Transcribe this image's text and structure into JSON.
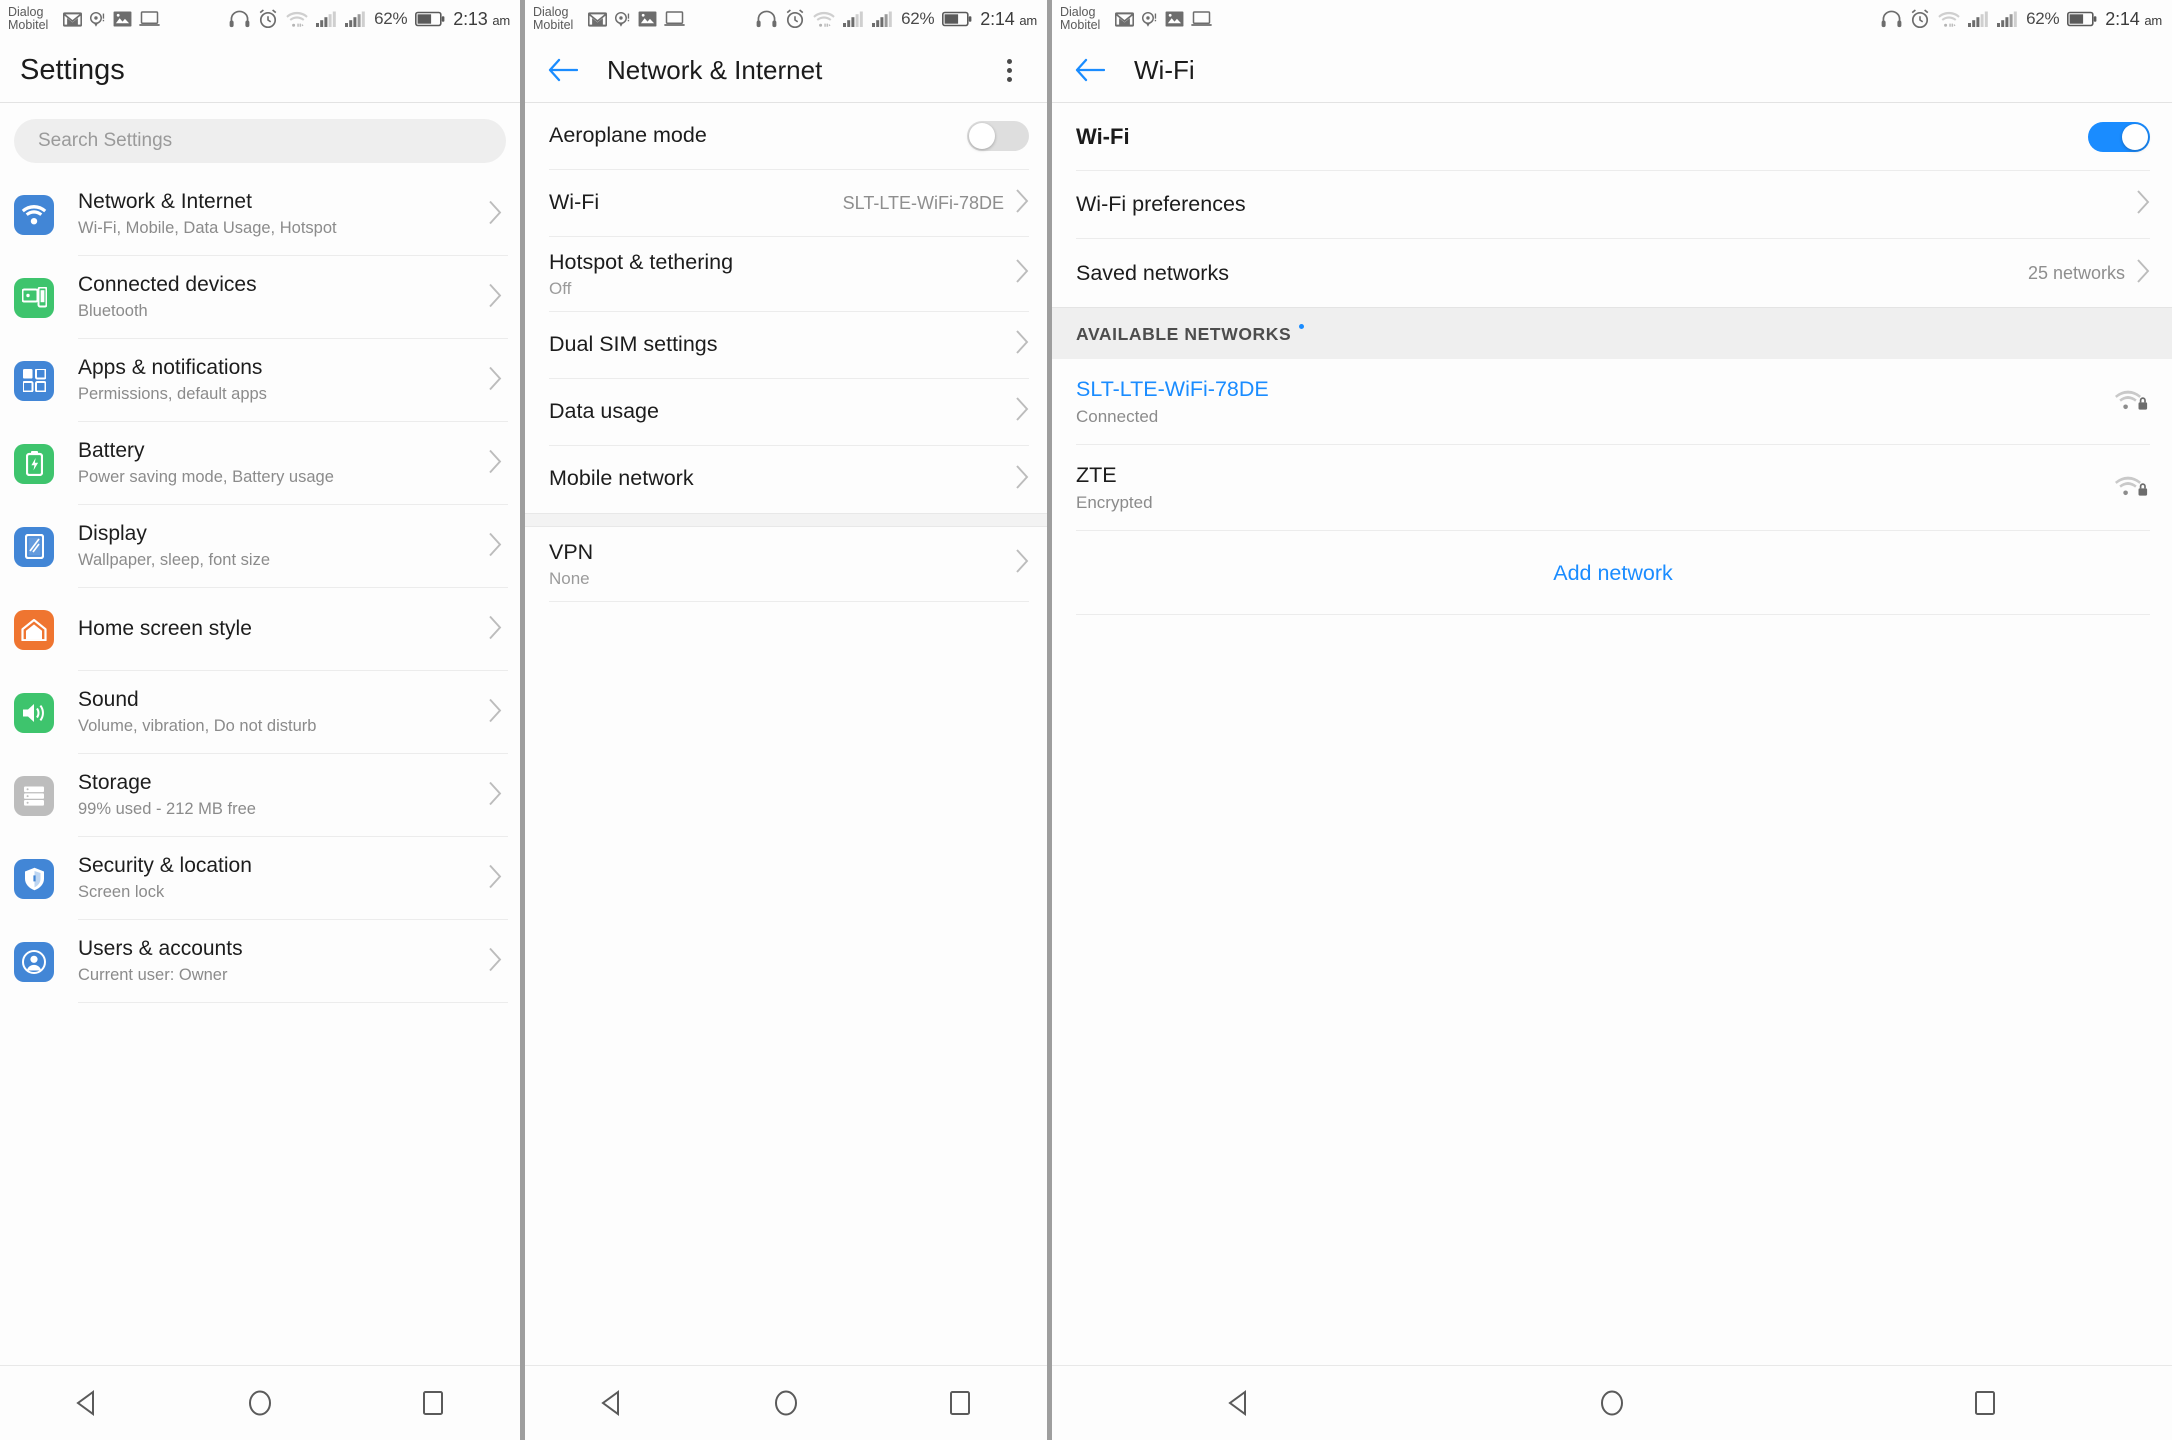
{
  "status_bar": {
    "carrier": "Dialog\nMobitel",
    "left_icons": [
      "gmail-icon",
      "location-alert-icon",
      "photo-icon",
      "laptop-icon"
    ],
    "right_icons": [
      "headset-icon",
      "alarm-icon",
      "wifi-icon",
      "signal-sim1-icon",
      "signal-sim2-icon"
    ],
    "battery_percent": "62%",
    "battery_icon": "battery-icon",
    "time_1": "2:13",
    "time_2": "2:14",
    "time_3": "2:14",
    "ampm": "am"
  },
  "panel_settings": {
    "title": "Settings",
    "search": {
      "placeholder": "Search Settings",
      "icon": "search-icon"
    },
    "items": [
      {
        "title": "Network & Internet",
        "sub": "Wi-Fi, Mobile, Data Usage, Hotspot",
        "icon": "wifi-icon",
        "color": "#4286d6"
      },
      {
        "title": "Connected devices",
        "sub": "Bluetooth",
        "icon": "devices-icon",
        "color": "#3ec46d"
      },
      {
        "title": "Apps & notifications",
        "sub": "Permissions, default apps",
        "icon": "apps-icon",
        "color": "#4286d6"
      },
      {
        "title": "Battery",
        "sub": "Power saving mode, Battery usage",
        "icon": "battery-icon",
        "color": "#3ec46d"
      },
      {
        "title": "Display",
        "sub": "Wallpaper, sleep, font size",
        "icon": "display-icon",
        "color": "#4286d6"
      },
      {
        "title": "Home screen style",
        "sub": "",
        "icon": "home-icon",
        "color": "#ef7530"
      },
      {
        "title": "Sound",
        "sub": "Volume, vibration, Do not disturb",
        "icon": "sound-icon",
        "color": "#3ec46d"
      },
      {
        "title": "Storage",
        "sub": "99% used - 212 MB free",
        "icon": "storage-icon",
        "color": "#bdbdbd"
      },
      {
        "title": "Security & location",
        "sub": "Screen lock",
        "icon": "shield-icon",
        "color": "#4286d6"
      },
      {
        "title": "Users & accounts",
        "sub": "Current user: Owner",
        "icon": "user-icon",
        "color": "#4286d6"
      }
    ]
  },
  "panel_network": {
    "title": "Network & Internet",
    "back_icon": "back-arrow-icon",
    "overflow_icon": "overflow-menu-icon",
    "items": [
      {
        "title": "Aeroplane mode",
        "sub": "",
        "value": "",
        "control": "toggle",
        "toggle_on": false
      },
      {
        "title": "Wi-Fi",
        "sub": "",
        "value": "SLT-LTE-WiFi-78DE",
        "control": "chevron"
      },
      {
        "title": "Hotspot & tethering",
        "sub": "Off",
        "value": "",
        "control": "chevron"
      },
      {
        "title": "Dual SIM settings",
        "sub": "",
        "value": "",
        "control": "chevron"
      },
      {
        "title": "Data usage",
        "sub": "",
        "value": "",
        "control": "chevron"
      },
      {
        "title": "Mobile network",
        "sub": "",
        "value": "",
        "control": "chevron"
      }
    ],
    "items_after_gap": [
      {
        "title": "VPN",
        "sub": "None",
        "value": "",
        "control": "chevron"
      }
    ]
  },
  "panel_wifi": {
    "title": "Wi-Fi",
    "back_icon": "back-arrow-icon",
    "wifi_toggle_label": "Wi-Fi",
    "wifi_toggle_on": true,
    "preferences_label": "Wi-Fi preferences",
    "saved_networks_label": "Saved networks",
    "saved_networks_value": "25 networks",
    "available_header": "AVAILABLE NETWORKS",
    "networks": [
      {
        "ssid": "SLT-LTE-WiFi-78DE",
        "status": "Connected",
        "connected": true,
        "icon": "wifi-lock-icon"
      },
      {
        "ssid": "ZTE",
        "status": "Encrypted",
        "connected": false,
        "icon": "wifi-lock-icon"
      }
    ],
    "add_network_label": "Add network"
  },
  "nav_bar": {
    "back": "nav-back-icon",
    "home": "nav-home-icon",
    "recents": "nav-recents-icon"
  },
  "colors": {
    "accent_blue": "#1a8cff",
    "toggle_off": "#dedede",
    "divider": "#ececec",
    "section_bg": "#efefef"
  }
}
